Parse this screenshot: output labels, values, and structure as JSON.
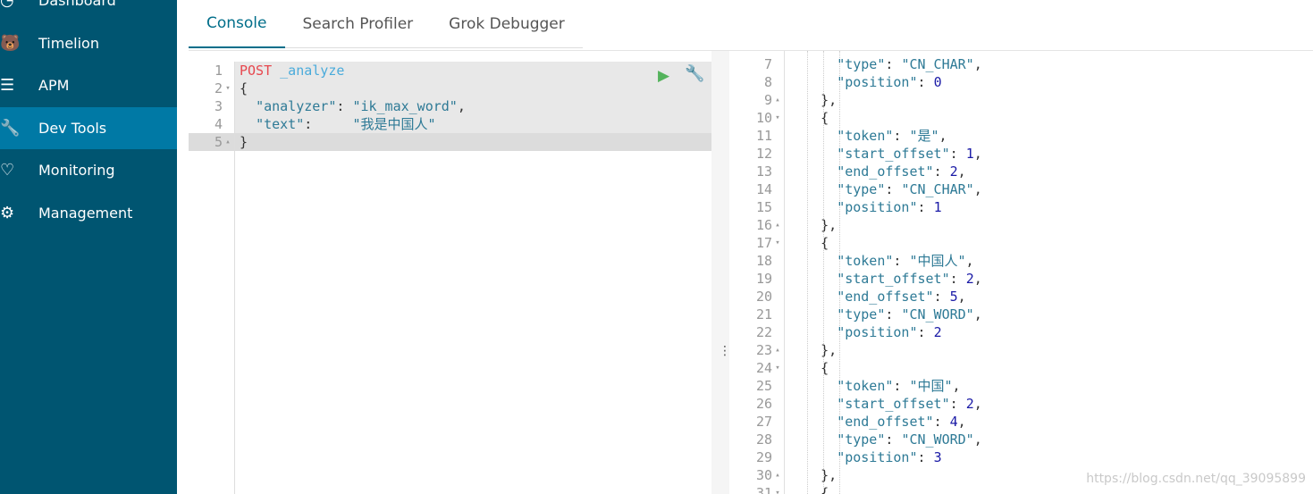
{
  "sidebar": {
    "items": [
      {
        "label": "Dashboard",
        "icon": "dashboard-icon"
      },
      {
        "label": "Timelion",
        "icon": "timelion-icon"
      },
      {
        "label": "APM",
        "icon": "apm-icon"
      },
      {
        "label": "Dev Tools",
        "icon": "wrench-icon",
        "active": true
      },
      {
        "label": "Monitoring",
        "icon": "heartbeat-icon"
      },
      {
        "label": "Management",
        "icon": "gear-icon"
      }
    ]
  },
  "tabs": [
    {
      "label": "Console",
      "active": true
    },
    {
      "label": "Search Profiler"
    },
    {
      "label": "Grok Debugger"
    }
  ],
  "colors": {
    "sidebar": "#005571",
    "active": "#0079a5",
    "run": "#54b35c",
    "method": "#e7474e"
  },
  "request": {
    "lines": [
      {
        "n": "1",
        "fold": "",
        "parts": [
          [
            "POST",
            "m"
          ],
          [
            " _analyze",
            "u"
          ]
        ]
      },
      {
        "n": "2",
        "fold": "▾",
        "parts": [
          [
            "{",
            "p"
          ]
        ]
      },
      {
        "n": "3",
        "fold": "",
        "parts": [
          [
            "  ",
            "p"
          ],
          [
            "\"analyzer\"",
            "k"
          ],
          [
            ": ",
            "p"
          ],
          [
            "\"ik_max_word\"",
            "s"
          ],
          [
            ",",
            "p"
          ]
        ]
      },
      {
        "n": "4",
        "fold": "",
        "parts": [
          [
            "  ",
            "p"
          ],
          [
            "\"text\"",
            "k"
          ],
          [
            ":     ",
            "p"
          ],
          [
            "\"我是中国人\"",
            "s"
          ]
        ]
      },
      {
        "n": "5",
        "fold": "▴",
        "parts": [
          [
            "}",
            "p"
          ]
        ]
      }
    ]
  },
  "response": {
    "lines": [
      {
        "n": "7",
        "fold": "",
        "parts": [
          [
            "      ",
            "p"
          ],
          [
            "\"type\"",
            "k"
          ],
          [
            ": ",
            "p"
          ],
          [
            "\"CN_CHAR\"",
            "s"
          ],
          [
            ",",
            "p"
          ]
        ]
      },
      {
        "n": "8",
        "fold": "",
        "parts": [
          [
            "      ",
            "p"
          ],
          [
            "\"position\"",
            "k"
          ],
          [
            ": ",
            "p"
          ],
          [
            "0",
            "n"
          ]
        ]
      },
      {
        "n": "9",
        "fold": "▴",
        "parts": [
          [
            "    },",
            "p"
          ]
        ]
      },
      {
        "n": "10",
        "fold": "▾",
        "parts": [
          [
            "    {",
            "p"
          ]
        ]
      },
      {
        "n": "11",
        "fold": "",
        "parts": [
          [
            "      ",
            "p"
          ],
          [
            "\"token\"",
            "k"
          ],
          [
            ": ",
            "p"
          ],
          [
            "\"是\"",
            "s"
          ],
          [
            ",",
            "p"
          ]
        ]
      },
      {
        "n": "12",
        "fold": "",
        "parts": [
          [
            "      ",
            "p"
          ],
          [
            "\"start_offset\"",
            "k"
          ],
          [
            ": ",
            "p"
          ],
          [
            "1",
            "n"
          ],
          [
            ",",
            "p"
          ]
        ]
      },
      {
        "n": "13",
        "fold": "",
        "parts": [
          [
            "      ",
            "p"
          ],
          [
            "\"end_offset\"",
            "k"
          ],
          [
            ": ",
            "p"
          ],
          [
            "2",
            "n"
          ],
          [
            ",",
            "p"
          ]
        ]
      },
      {
        "n": "14",
        "fold": "",
        "parts": [
          [
            "      ",
            "p"
          ],
          [
            "\"type\"",
            "k"
          ],
          [
            ": ",
            "p"
          ],
          [
            "\"CN_CHAR\"",
            "s"
          ],
          [
            ",",
            "p"
          ]
        ]
      },
      {
        "n": "15",
        "fold": "",
        "parts": [
          [
            "      ",
            "p"
          ],
          [
            "\"position\"",
            "k"
          ],
          [
            ": ",
            "p"
          ],
          [
            "1",
            "n"
          ]
        ]
      },
      {
        "n": "16",
        "fold": "▴",
        "parts": [
          [
            "    },",
            "p"
          ]
        ]
      },
      {
        "n": "17",
        "fold": "▾",
        "parts": [
          [
            "    {",
            "p"
          ]
        ]
      },
      {
        "n": "18",
        "fold": "",
        "parts": [
          [
            "      ",
            "p"
          ],
          [
            "\"token\"",
            "k"
          ],
          [
            ": ",
            "p"
          ],
          [
            "\"中国人\"",
            "s"
          ],
          [
            ",",
            "p"
          ]
        ]
      },
      {
        "n": "19",
        "fold": "",
        "parts": [
          [
            "      ",
            "p"
          ],
          [
            "\"start_offset\"",
            "k"
          ],
          [
            ": ",
            "p"
          ],
          [
            "2",
            "n"
          ],
          [
            ",",
            "p"
          ]
        ]
      },
      {
        "n": "20",
        "fold": "",
        "parts": [
          [
            "      ",
            "p"
          ],
          [
            "\"end_offset\"",
            "k"
          ],
          [
            ": ",
            "p"
          ],
          [
            "5",
            "n"
          ],
          [
            ",",
            "p"
          ]
        ]
      },
      {
        "n": "21",
        "fold": "",
        "parts": [
          [
            "      ",
            "p"
          ],
          [
            "\"type\"",
            "k"
          ],
          [
            ": ",
            "p"
          ],
          [
            "\"CN_WORD\"",
            "s"
          ],
          [
            ",",
            "p"
          ]
        ]
      },
      {
        "n": "22",
        "fold": "",
        "parts": [
          [
            "      ",
            "p"
          ],
          [
            "\"position\"",
            "k"
          ],
          [
            ": ",
            "p"
          ],
          [
            "2",
            "n"
          ]
        ]
      },
      {
        "n": "23",
        "fold": "▴",
        "parts": [
          [
            "    },",
            "p"
          ]
        ]
      },
      {
        "n": "24",
        "fold": "▾",
        "parts": [
          [
            "    {",
            "p"
          ]
        ]
      },
      {
        "n": "25",
        "fold": "",
        "parts": [
          [
            "      ",
            "p"
          ],
          [
            "\"token\"",
            "k"
          ],
          [
            ": ",
            "p"
          ],
          [
            "\"中国\"",
            "s"
          ],
          [
            ",",
            "p"
          ]
        ]
      },
      {
        "n": "26",
        "fold": "",
        "parts": [
          [
            "      ",
            "p"
          ],
          [
            "\"start_offset\"",
            "k"
          ],
          [
            ": ",
            "p"
          ],
          [
            "2",
            "n"
          ],
          [
            ",",
            "p"
          ]
        ]
      },
      {
        "n": "27",
        "fold": "",
        "parts": [
          [
            "      ",
            "p"
          ],
          [
            "\"end_offset\"",
            "k"
          ],
          [
            ": ",
            "p"
          ],
          [
            "4",
            "n"
          ],
          [
            ",",
            "p"
          ]
        ]
      },
      {
        "n": "28",
        "fold": "",
        "parts": [
          [
            "      ",
            "p"
          ],
          [
            "\"type\"",
            "k"
          ],
          [
            ": ",
            "p"
          ],
          [
            "\"CN_WORD\"",
            "s"
          ],
          [
            ",",
            "p"
          ]
        ]
      },
      {
        "n": "29",
        "fold": "",
        "parts": [
          [
            "      ",
            "p"
          ],
          [
            "\"position\"",
            "k"
          ],
          [
            ": ",
            "p"
          ],
          [
            "3",
            "n"
          ]
        ]
      },
      {
        "n": "30",
        "fold": "▴",
        "parts": [
          [
            "    },",
            "p"
          ]
        ]
      },
      {
        "n": "31",
        "fold": "▾",
        "parts": [
          [
            "    {",
            "p"
          ]
        ]
      }
    ]
  },
  "watermark": "https://blog.csdn.net/qq_39095899"
}
